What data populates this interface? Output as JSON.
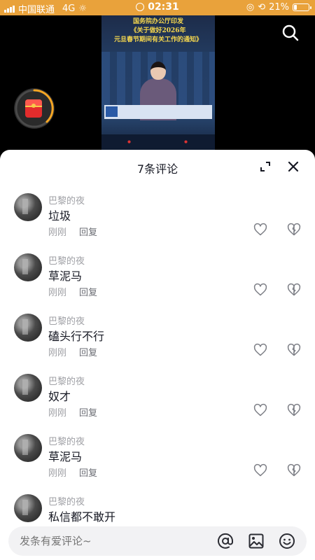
{
  "status_bar": {
    "carrier": "中国联通",
    "network": "4G",
    "time": "02:31",
    "battery": "21%",
    "battery_level": 0.21
  },
  "video": {
    "headline_lines": [
      "国务院办公厅印发",
      "《关于做好2026年",
      "元旦春节期间有关工作的通知》"
    ]
  },
  "comments_panel": {
    "title": "7条评论",
    "comments": [
      {
        "user": "巴黎的夜",
        "text": "垃圾",
        "time": "刚刚",
        "reply": "回复"
      },
      {
        "user": "巴黎的夜",
        "text": "草泥马",
        "time": "刚刚",
        "reply": "回复"
      },
      {
        "user": "巴黎的夜",
        "text": "磕头行不行",
        "time": "刚刚",
        "reply": "回复"
      },
      {
        "user": "巴黎的夜",
        "text": "奴才",
        "time": "刚刚",
        "reply": "回复"
      },
      {
        "user": "巴黎的夜",
        "text": "草泥马",
        "time": "刚刚",
        "reply": "回复"
      },
      {
        "user": "巴黎的夜",
        "text": "私信都不敢开",
        "time": "",
        "reply": ""
      }
    ]
  },
  "input": {
    "placeholder": "发条有爱评论~"
  },
  "icons": {
    "search": "search-icon",
    "expand": "expand-icon",
    "close": "close-icon",
    "like": "heart-icon",
    "dislike": "broken-heart-icon",
    "mention": "at-icon",
    "image": "image-icon",
    "emoji": "emoji-icon",
    "red_packet": "red-packet-icon"
  },
  "colors": {
    "status_bar": "#e9a23b",
    "headline": "#f4d64e",
    "progress_ring": "#f5a623"
  }
}
